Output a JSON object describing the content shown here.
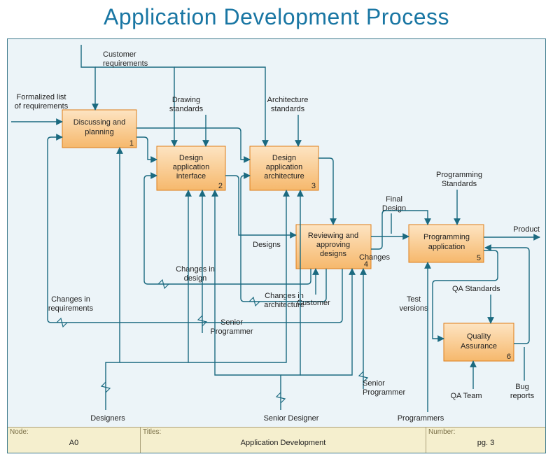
{
  "title": "Application Development Process",
  "boxes": {
    "b1": {
      "l1": "Discussing and",
      "l2": "planning",
      "num": "1"
    },
    "b2": {
      "l1": "Design",
      "l2": "application",
      "l3": "interface",
      "num": "2"
    },
    "b3": {
      "l1": "Design",
      "l2": "application",
      "l3": "architecture",
      "num": "3"
    },
    "b4": {
      "l1": "Reviewing and",
      "l2": "approving",
      "l3": "designs",
      "num": "4"
    },
    "b5": {
      "l1": "Programming",
      "l2": "application",
      "num": "5"
    },
    "b6": {
      "l1": "Quality",
      "l2": "Assurance",
      "num": "6"
    }
  },
  "labels": {
    "custReq1": "Customer",
    "custReq2": "requirements",
    "formList1": "Formalized list",
    "formList2": "of requirements",
    "drawStd1": "Drawing",
    "drawStd2": "standards",
    "archStd1": "Architecture",
    "archStd2": "standards",
    "progStd1": "Programming",
    "progStd2": "Standards",
    "finalDesign1": "Final",
    "finalDesign2": "Design",
    "product": "Product",
    "designs": "Designs",
    "changes": "Changes",
    "changesDesign1": "Changes in",
    "changesDesign2": "design",
    "changesArch1": "Changes in",
    "changesArch2": "architecture",
    "changesReq1": "Changes in",
    "changesReq2": "requirements",
    "customer": "Customer",
    "seniorProg": "Senior",
    "seniorProg2": "Programmer",
    "seniorDesigner": "Senior Designer",
    "seniorProgR1": "Senior",
    "seniorProgR2": "Programmer",
    "designers": "Designers",
    "programmers": "Programmers",
    "qaTeam": "QA Team",
    "qaStd": "QA Standards",
    "testVer1": "Test",
    "testVer2": "versions",
    "bugRep1": "Bug",
    "bugRep2": "reports"
  },
  "footer": {
    "nodeKey": "Node:",
    "nodeVal": "A0",
    "titlesKey": "Titles:",
    "titlesVal": "Application Development",
    "numberKey": "Number:",
    "numberVal": "pg. 3"
  },
  "colors": {
    "stroke": "#1b6a80",
    "boxFillTop": "#fde0b8",
    "boxFillBottom": "#f7b971",
    "boxStroke": "#de7e1a"
  }
}
